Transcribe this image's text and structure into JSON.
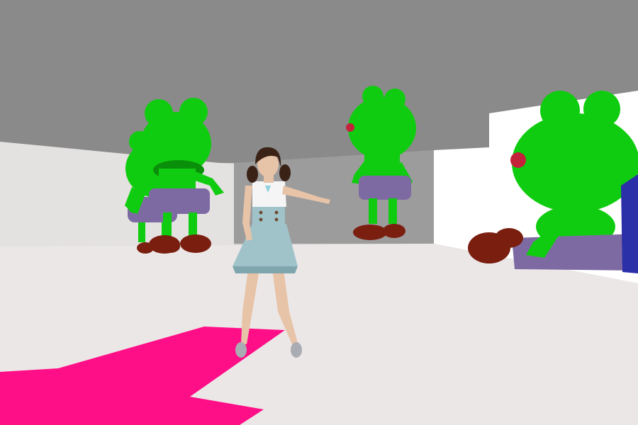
{
  "scene": {
    "colors": {
      "ceiling": "#8a8a8a",
      "back_wall": "#9c9c9c",
      "left_wall": "#e4e1e1",
      "floor": "#ece7e7",
      "right_opening": "#ffffff",
      "path_marker": "#ff0f87",
      "frog_green": "#10cc10",
      "frog_shadow": "#0a8f0a",
      "frog_pants": "#7e6aa3",
      "frog_boots": "#7a1f10",
      "frog_cheek": "#c4213a",
      "blue_object": "#2b2fa8",
      "skirt": "#9fc3c9",
      "blouse": "#f5f5f5",
      "hair": "#3a2216",
      "skin": "#e7c3a8",
      "shoes": "#a9adb3"
    },
    "objects": [
      "frog-statue-left-back",
      "frog-statue-left-front",
      "frog-statue-center",
      "frog-statue-right",
      "player-avatar",
      "floor-path-marker",
      "blue-object"
    ]
  }
}
